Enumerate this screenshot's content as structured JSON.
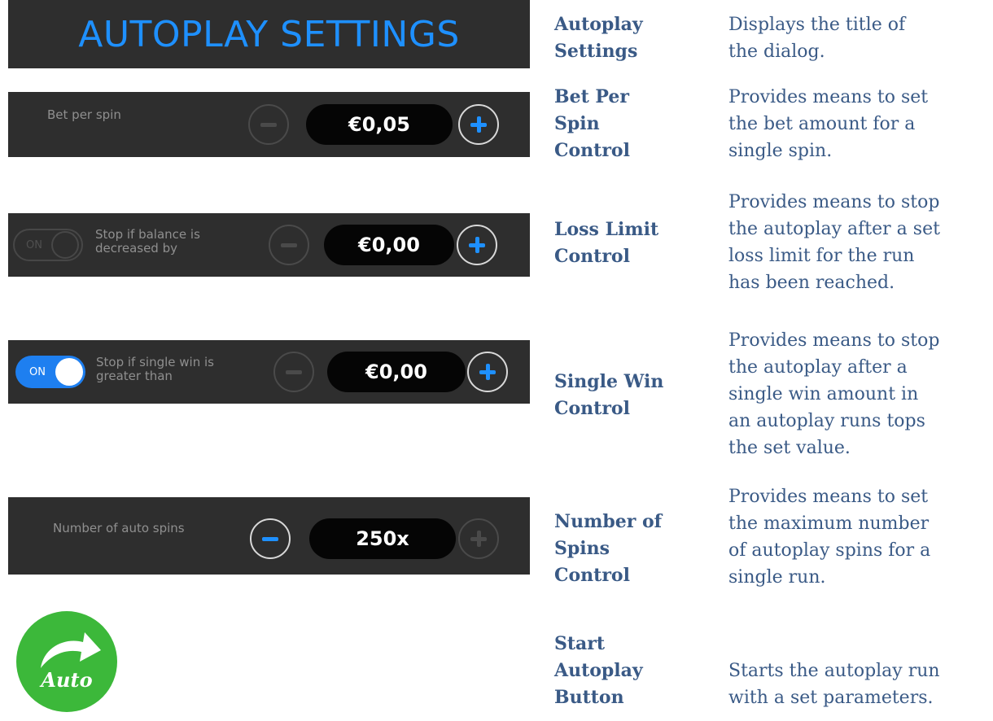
{
  "dialog_title": "AUTOPLAY SETTINGS",
  "bet_per_spin": {
    "label": "Bet per spin",
    "value": "€0,05"
  },
  "loss_limit": {
    "toggle": "ON",
    "label_line1": "Stop if balance is",
    "label_line2": "decreased by",
    "value": "€0,00"
  },
  "single_win": {
    "toggle": "ON",
    "label_line1": "Stop if single win is",
    "label_line2": "greater than",
    "value": "€0,00"
  },
  "auto_spins": {
    "label": "Number of auto spins",
    "value": "250x"
  },
  "auto_button": {
    "label": "Auto"
  },
  "colors": {
    "accent": "#1e90ff",
    "panel": "#2e2e2e",
    "auto_green": "#3cb83a",
    "text": "#3a5a86"
  },
  "table": [
    {
      "term_lines": [
        "Autoplay",
        "Settings"
      ],
      "desc_lines": [
        "Displays the title of",
        "the dialog."
      ]
    },
    {
      "term_lines": [
        "Bet Per",
        "Spin",
        "Control"
      ],
      "desc_lines": [
        "Provides means to set",
        "the bet amount for a",
        "single spin."
      ]
    },
    {
      "term_lines": [
        "Loss Limit",
        "Control"
      ],
      "desc_lines": [
        "Provides means to stop",
        "the autoplay after a set",
        "loss limit for the run",
        "has been reached."
      ]
    },
    {
      "term_lines": [
        "Single Win",
        "Control"
      ],
      "desc_lines": [
        "Provides means to stop",
        "the autoplay after a",
        "single win amount in",
        "an autoplay runs tops",
        "the set value."
      ]
    },
    {
      "term_lines": [
        "Number of",
        "Spins",
        "Control"
      ],
      "desc_lines": [
        "Provides means to set",
        "the maximum number",
        "of autoplay spins for a",
        "single run."
      ]
    },
    {
      "term_lines": [
        "Start",
        "Autoplay",
        "Button"
      ],
      "desc_lines": [
        "Starts the autoplay run",
        "with a set parameters."
      ]
    }
  ]
}
